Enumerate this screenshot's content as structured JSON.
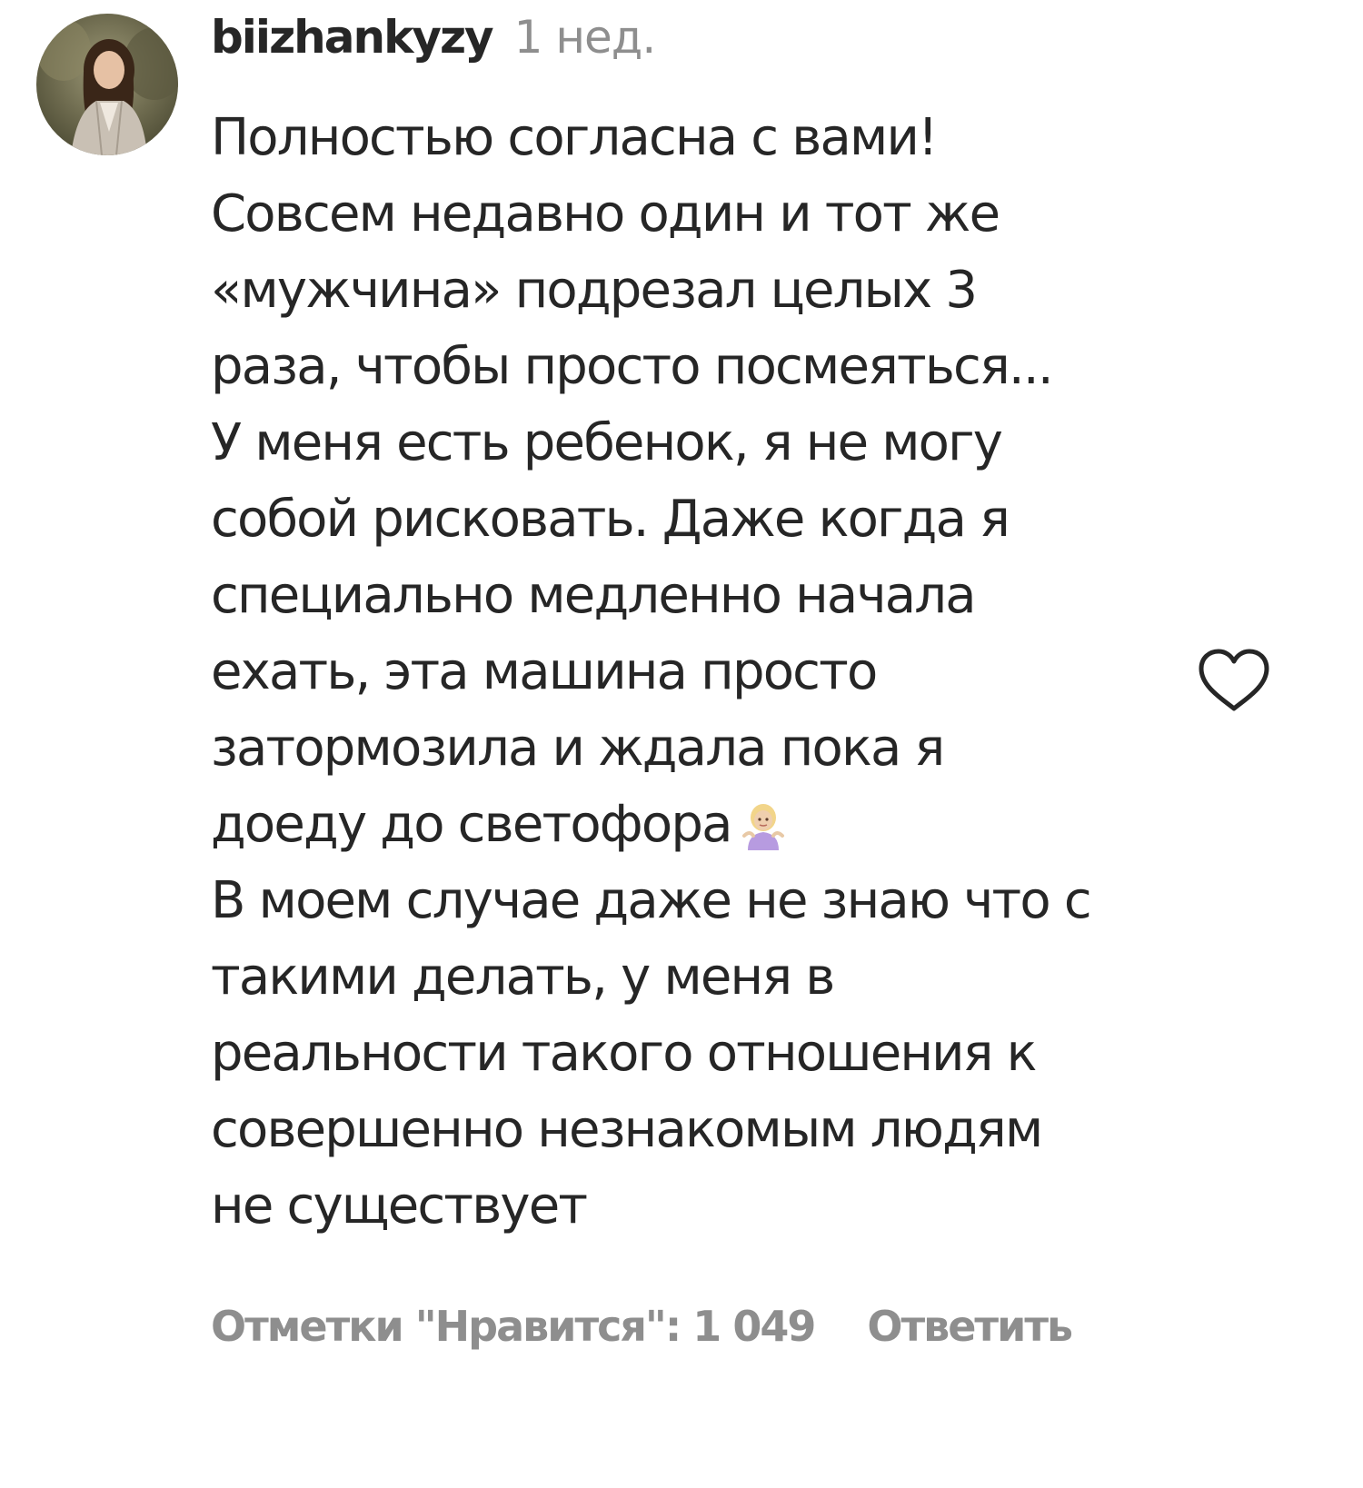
{
  "comment": {
    "username": "biizhankyzy",
    "timestamp": "1 нед.",
    "lines": [
      "Полностью согласна с вами!",
      "Совсем недавно один и тот же",
      "«мужчина» подрезал целых 3",
      "раза, чтобы просто посмеяться...",
      "У меня есть ребенок, я не могу",
      "собой рисковать. Даже когда я",
      "специально медленно начала",
      "ехать, эта машина просто",
      "затормозила и ждала пока я",
      "доеду до светофора",
      "В моем случае даже не знаю что с",
      "такими делать, у меня в",
      "реальности такого отношения к",
      "совершенно незнакомым людям",
      "не существует"
    ],
    "emoji": "woman-shrugging-emoji",
    "likes_label": "Отметки \"Нравится\": 1 049",
    "reply_label": "Ответить"
  },
  "icons": {
    "like": "heart-outline-icon",
    "avatar": "user-avatar"
  },
  "colors": {
    "text": "#262626",
    "secondary": "#8e8e8e",
    "background": "#ffffff",
    "emoji_hair": "#f2d58a",
    "emoji_shirt": "#b79be0"
  }
}
